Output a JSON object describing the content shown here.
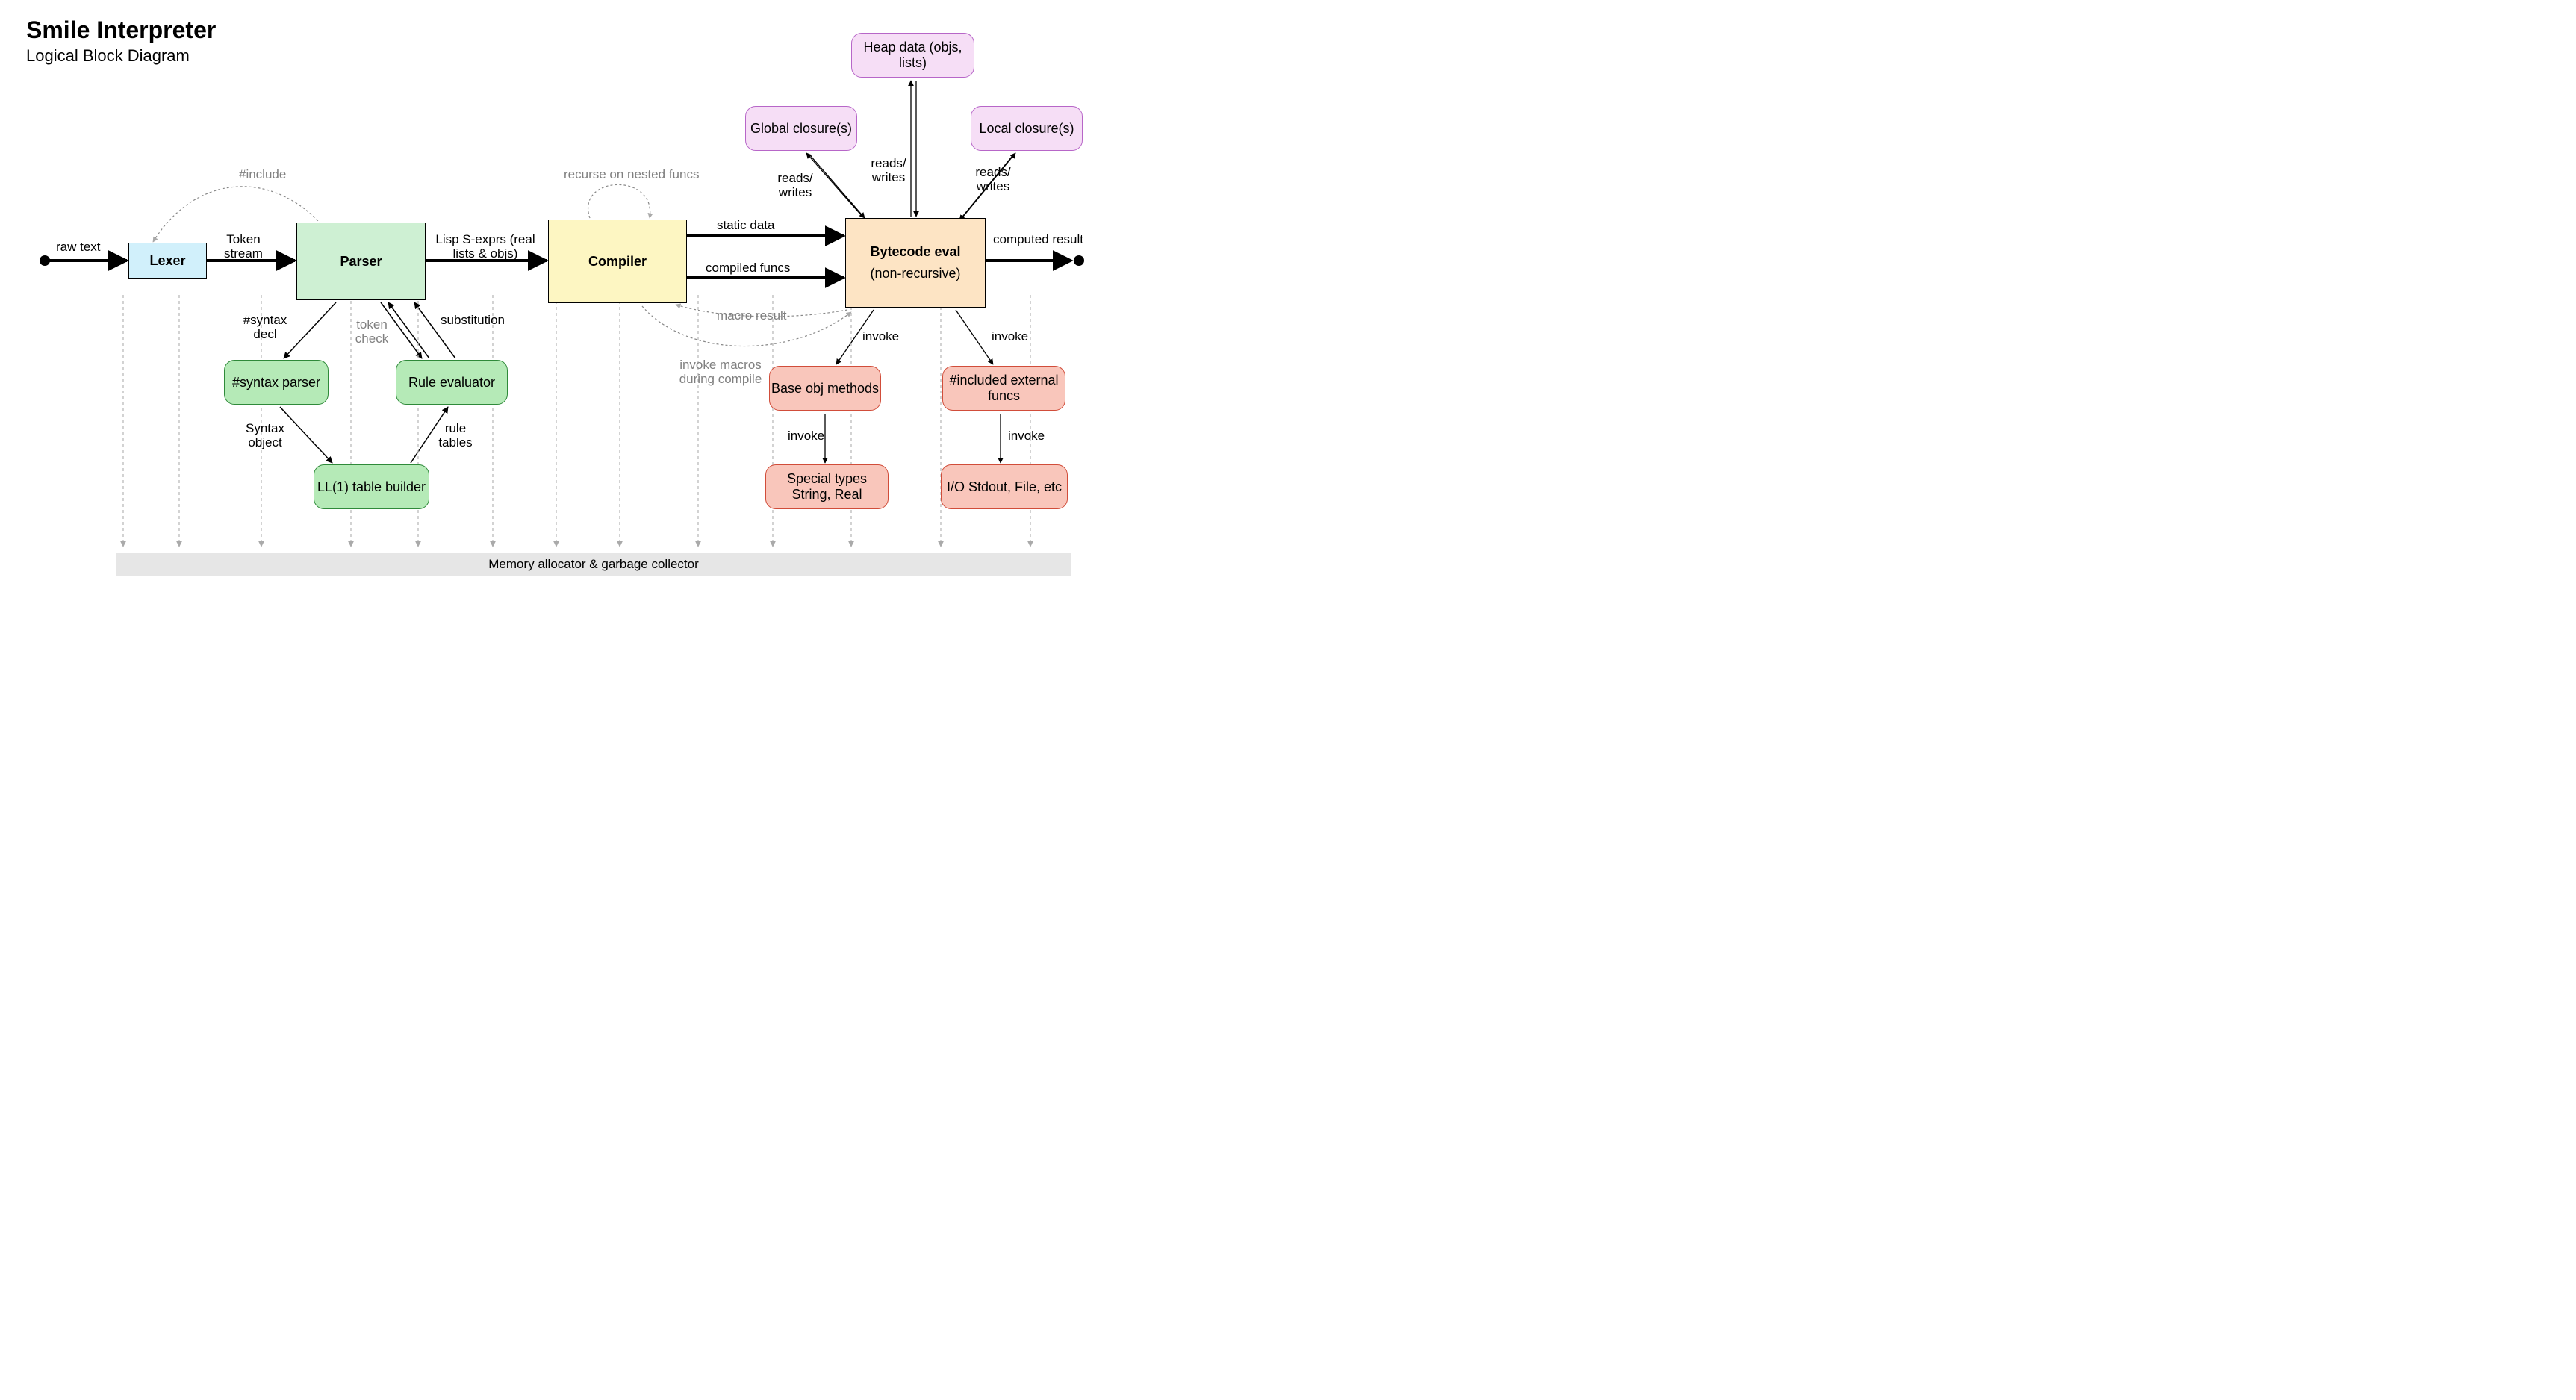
{
  "header": {
    "title": "Smile Interpreter",
    "subtitle": "Logical Block Diagram"
  },
  "blocks": {
    "lexer": "Lexer",
    "parser": "Parser",
    "compiler": "Compiler",
    "eval_title": "Bytecode eval",
    "eval_sub": "(non-recursive)",
    "syntax_parser": "#syntax parser",
    "rule_eval": "Rule evaluator",
    "ll1": "LL(1) table builder",
    "global_closures": "Global closure(s)",
    "heap_data": "Heap data (objs, lists)",
    "local_closures": "Local closure(s)",
    "base_obj": "Base obj methods",
    "included_ext": "#included external funcs",
    "special_types": "Special types String, Real",
    "io": "I/O Stdout, File, etc",
    "memory": "Memory allocator & garbage collector"
  },
  "edges": {
    "raw_text": "raw text",
    "token_stream": "Token stream",
    "lisp_sexprs": "Lisp S-exprs (real lists & objs)",
    "static_data": "static data",
    "compiled_funcs": "compiled funcs",
    "computed_result": "computed result",
    "include": "#include",
    "recurse_nested": "recurse on nested funcs",
    "macro_result": "macro result",
    "invoke_macros": "invoke macros during compile",
    "syntax_decl": "#syntax decl",
    "token_check": "token check",
    "substitution": "substitution",
    "syntax_object": "Syntax object",
    "rule_tables": "rule tables",
    "reads_writes": "reads/ writes",
    "invoke": "invoke"
  }
}
